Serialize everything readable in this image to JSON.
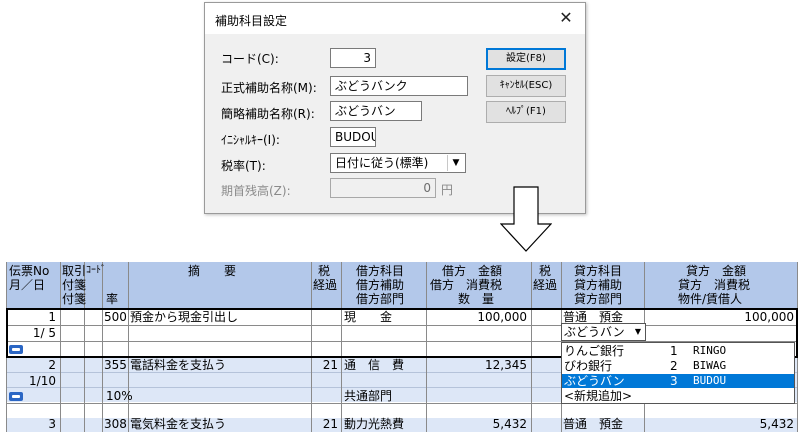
{
  "dialog": {
    "title": "補助科目設定",
    "close_glyph": "✕",
    "fields": {
      "code_label": "コード(C):",
      "code_value": "3",
      "formal_label": "正式補助名称(M):",
      "formal_value": "ぶどうバンク",
      "short_label": "簡略補助名称(R):",
      "short_value": "ぶどうバン",
      "initial_label": "ｲﾆｼｬﾙｷｰ(I):",
      "initial_value": "BUDOU",
      "tax_label": "税率(T):",
      "tax_value": "日付に従う(標準)",
      "opening_label": "期首残高(Z):",
      "opening_value": "0",
      "opening_unit": "円"
    },
    "buttons": {
      "settings": "設定(F8)",
      "cancel": "ｷｬﾝｾﾙ(ESC)",
      "help": "ﾍﾙﾌﾟ(F1)"
    }
  },
  "grid": {
    "headers": {
      "slip_no": "伝票No",
      "month_day": "月／日",
      "torihiki": "取引",
      "fusen1": "付箋",
      "fusen2": "付箋",
      "code": "ｺｰﾄﾞ",
      "rate": "率",
      "summary": "摘　　要",
      "tax1": "税",
      "keito1": "経過",
      "debit_account": "借方科目",
      "debit_sub": "借方補助",
      "debit_dept": "借方部門",
      "debit_amount": "借方　金額",
      "debit_tax": "借方　消費税",
      "quantity": "数　量",
      "tax2": "税",
      "keito2": "経過",
      "credit_account": "貸方科目",
      "credit_sub": "貸方補助",
      "credit_dept": "貸方部門",
      "credit_amount": "貸方　金額",
      "credit_tax": "貸方　消費税",
      "property": "物件/賃借人"
    },
    "rows": [
      {
        "slip": "1",
        "date": "1/ 5",
        "code": "500",
        "summary": "預金から現金引出し",
        "debit_account": "現　　金",
        "debit_amount": "100,000",
        "credit_account": "普通　預金",
        "credit_amount": "100,000",
        "credit_sub_combo": "ぶどうバン"
      },
      {
        "slip": "2",
        "date": "1/10",
        "code": "355",
        "summary": "電話料金を支払う",
        "tax": "21",
        "debit_account": "通　信　費",
        "debit_amount": "12,345",
        "rate": "10%",
        "debit_dept": "共通部門"
      },
      {
        "slip": "3",
        "code": "308",
        "summary": "電気料金を支払う",
        "tax": "21",
        "debit_account": "動力光熱費",
        "debit_amount": "5,432",
        "credit_account": "普通　預金",
        "credit_amount": "5,432"
      }
    ],
    "dropdown_options": [
      {
        "name": "りんご銀行",
        "no": "1",
        "code": "RINGO"
      },
      {
        "name": "びわ銀行",
        "no": "2",
        "code": "BIWAG"
      },
      {
        "name": "ぶどうバン",
        "no": "3",
        "code": "BUDOU",
        "selected": true
      },
      {
        "name": "<新規追加>",
        "no": "",
        "code": ""
      }
    ]
  },
  "colors": {
    "header_bg": "#b3c8ea",
    "band_bg": "#dde7f7",
    "selection": "#0078d7",
    "focus_border": "#0078d7"
  }
}
